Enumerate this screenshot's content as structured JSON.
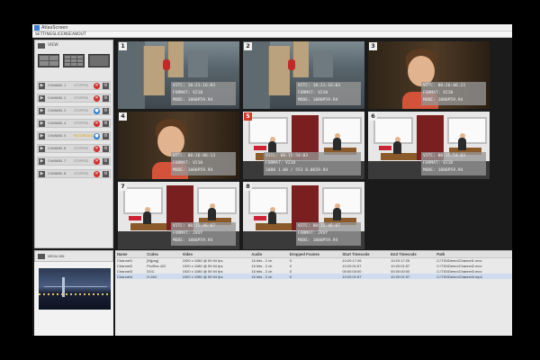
{
  "window": {
    "title": "AtlasScreen"
  },
  "menu": [
    "SETTINGS",
    "LICENSE",
    "ABOUT"
  ],
  "views": {
    "label": "VIEW"
  },
  "channels": [
    {
      "name": "CHANNEL 1",
      "status": "STOPPED",
      "recording": true
    },
    {
      "name": "CHANNEL 2",
      "status": "STOPPED",
      "recording": true
    },
    {
      "name": "CHANNEL 3",
      "status": "STOPPED",
      "recording": false
    },
    {
      "name": "CHANNEL 4",
      "status": "STOPPED",
      "recording": true
    },
    {
      "name": "CHANNEL 5",
      "status": "RECORDING",
      "recording": false
    },
    {
      "name": "CHANNEL 6",
      "status": "STOPPED",
      "recording": true
    },
    {
      "name": "CHANNEL 7",
      "status": "STOPPED",
      "recording": true
    },
    {
      "name": "CHANNEL 8",
      "status": "STOPPED",
      "recording": true
    }
  ],
  "media": {
    "label": "MEDIA BIN"
  },
  "tiles": [
    {
      "num": "1",
      "scene": "city",
      "red": false,
      "lines": [
        "VITC:   10:21:16:03",
        "FORMAT: V210",
        "MODE:   1080P59.94"
      ]
    },
    {
      "num": "2",
      "scene": "city",
      "red": false,
      "lines": [
        "VITC:   10:21:16:03",
        "FORMAT: V210",
        "MODE:   1080P59.94"
      ]
    },
    {
      "num": "3",
      "scene": "child",
      "red": false,
      "lines": [
        "VITC:   00:26:06:13",
        "FORMAT: V210",
        "MODE:   1080P59.94"
      ]
    },
    {
      "num": "4",
      "scene": "child",
      "red": false,
      "lines": [
        "VITC:   00:26:06:13",
        "FORMAT: V210",
        "MODE:   1080P59.94"
      ]
    },
    {
      "num": "5",
      "scene": "office",
      "red": true,
      "lines": [
        "VITC:   00:15:54:03",
        "FORMAT: V210",
        "1080 1.08 / 553 0.0659.94"
      ]
    },
    {
      "num": "6",
      "scene": "office",
      "red": false,
      "lines": [
        "VITC:   00:15:54:03",
        "FORMAT: V210",
        "MODE:   1080P59.94"
      ]
    },
    {
      "num": "7",
      "scene": "office",
      "red": false,
      "lines": [
        "VITC:   00:15:46:07",
        "FORMAT: 2VUY",
        "MODE:   1080P59.94"
      ]
    },
    {
      "num": "8",
      "scene": "office",
      "red": false,
      "lines": [
        "VITC:   00:15:46:07",
        "FORMAT: 2VUY",
        "MODE:   1080P59.94"
      ]
    }
  ],
  "table": {
    "headers": [
      "Name",
      "Codec",
      "Video",
      "Audio",
      "Dropped Frames",
      "Start Timecode",
      "End Timecode",
      "Path"
    ],
    "rows": [
      [
        "Channel1",
        "[Mjpeg]",
        "1920 x 1080 @ 59.94 fps",
        "16 bits - 2 ch",
        "0",
        "10:20:17:26",
        "10:20:17:26",
        "C:\\TID\\Demo\\Channel1.mov"
      ],
      [
        "Channel2",
        "ProRes 422",
        "1920 x 1080 @ 59.94 fps",
        "16 bits - 2 ch",
        "0",
        "10:20:01:57",
        "10:20:01:57",
        "C:\\TID\\Demo\\Channel2.mov"
      ],
      [
        "Channel3",
        "DVC",
        "1920 x 1080 @ 59.94 fps",
        "16 bits - 2 ch",
        "0",
        "00:00:00:00",
        "00:00:00:00",
        "C:\\TID\\Demo\\Channel3.mov"
      ],
      [
        "Channel4",
        "H.264",
        "1920 x 1080 @ 59.94 fps",
        "16 bits - 2 ch",
        "0",
        "10:20:01:57",
        "10:20:01:57",
        "C:\\TID\\Demo\\Channel4.mp4"
      ]
    ]
  }
}
